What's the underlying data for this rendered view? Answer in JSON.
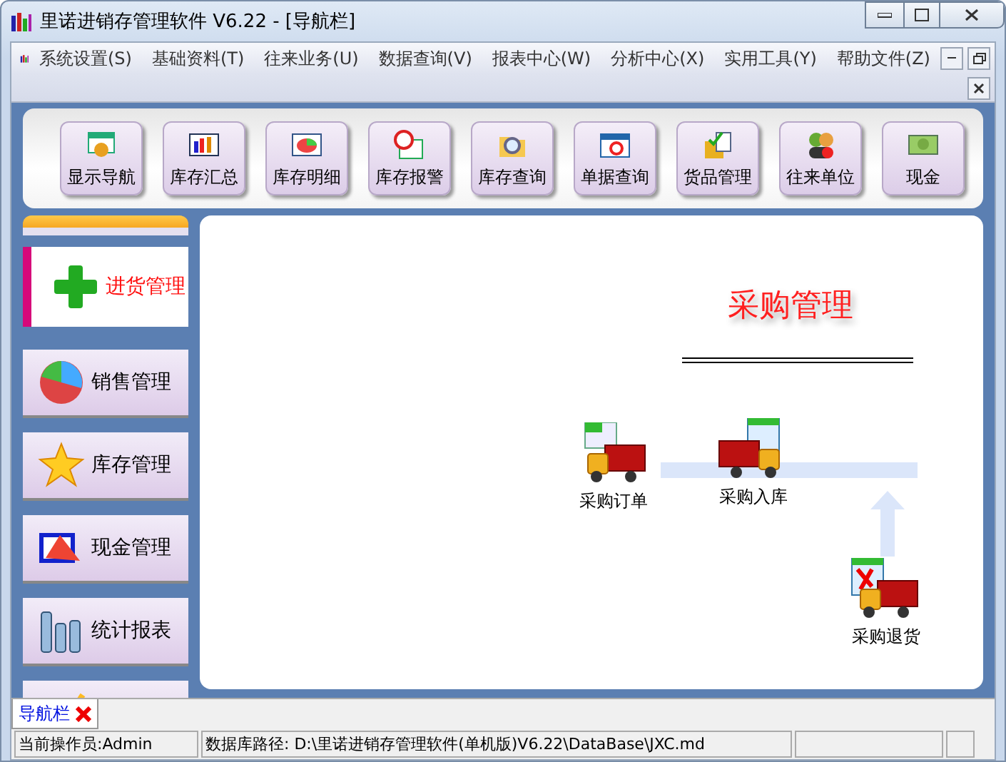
{
  "window": {
    "title": "里诺进销存管理软件 V6.22 - [导航栏]"
  },
  "menu": [
    "系统设置(S)",
    "基础资料(T)",
    "往来业务(U)",
    "数据查询(V)",
    "报表中心(W)",
    "分析中心(X)",
    "实用工具(Y)",
    "帮助文件(Z)"
  ],
  "toolbar": [
    "显示导航",
    "库存汇总",
    "库存明细",
    "库存报警",
    "库存查询",
    "单据查询",
    "货品管理",
    "往来单位",
    "现金"
  ],
  "sidebar": {
    "items": [
      {
        "label": "进货管理",
        "selected": true
      },
      {
        "label": "销售管理",
        "selected": false
      },
      {
        "label": "库存管理",
        "selected": false
      },
      {
        "label": "现金管理",
        "selected": false
      },
      {
        "label": "统计报表",
        "selected": false
      }
    ]
  },
  "panel": {
    "title": "采购管理",
    "nodes": [
      {
        "label": "采购订单"
      },
      {
        "label": "采购入库"
      },
      {
        "label": "采购退货"
      }
    ]
  },
  "tabs": [
    {
      "label": "导航栏",
      "selected": true
    }
  ],
  "status_bar": [
    "当前操作员:Admin",
    "数据库路径: D:\\里诺进销存管理软件(单机版)V6.22\\DataBase\\JXC.md"
  ]
}
